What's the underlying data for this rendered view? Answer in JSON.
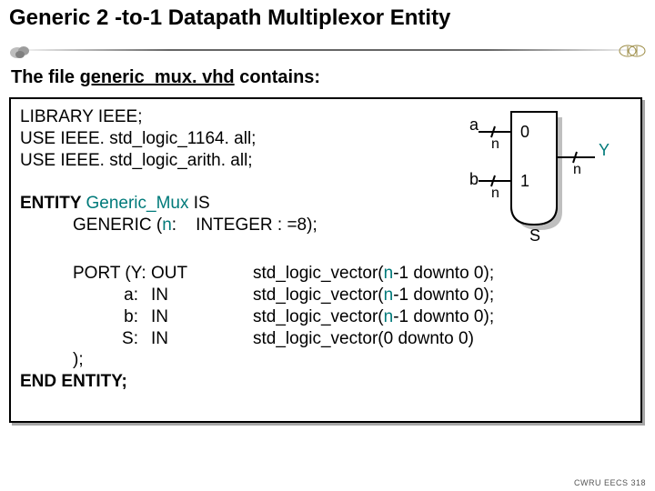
{
  "title": "Generic 2 -to-1 Datapath Multiplexor Entity",
  "subhead_prefix": "The file ",
  "subhead_file": "generic_mux. vhd",
  "subhead_suffix": " contains:",
  "code": {
    "line1": "LIBRARY IEEE;",
    "line2": "USE IEEE. std_logic_1164. all;",
    "line3": "USE IEEE. std_logic_arith. all;",
    "entity_kw": "ENTITY ",
    "entity_name": "Generic_Mux",
    "entity_is": " IS",
    "generic_pre": "GENERIC (",
    "generic_n": "n",
    "generic_post": ":    INTEGER : =8);",
    "port_kw": "PORT (",
    "ports": [
      {
        "name": "Y:",
        "dir": "OUT",
        "type_pre": "std_logic_vector(",
        "n": "n",
        "type_post": "-1 downto 0);"
      },
      {
        "name": "a:",
        "dir": "IN",
        "type_pre": "std_logic_vector(",
        "n": "n",
        "type_post": "-1 downto 0);"
      },
      {
        "name": "b:",
        "dir": "IN",
        "type_pre": "std_logic_vector(",
        "n": "n",
        "type_post": "-1 downto 0);"
      },
      {
        "name": "S:",
        "dir": "IN",
        "type_pre": "std_logic_vector(0 downto 0)",
        "n": "",
        "type_post": ""
      }
    ],
    "close_port": ");",
    "end": "END ENTITY;"
  },
  "mux": {
    "a": "a",
    "b": "b",
    "Y": "Y",
    "S": "S",
    "n": "n",
    "zero": "0",
    "one": "1"
  },
  "footer": "CWRU EECS 318"
}
